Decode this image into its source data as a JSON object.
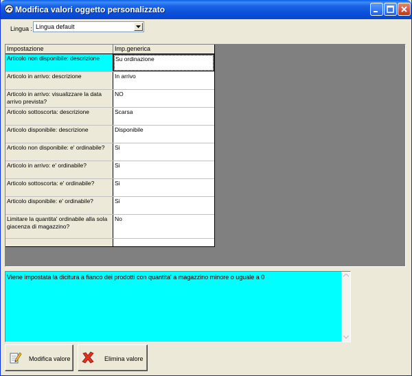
{
  "window": {
    "title": "Modifica valori oggetto personalizzato",
    "title_bar_color": "#0A5FE8"
  },
  "language": {
    "label": "Lingua :",
    "selected": "Lingua default"
  },
  "grid": {
    "columns": [
      "Impostazione",
      "Imp.generica"
    ],
    "rows": [
      {
        "setting": "Articolo non disponibile: descrizione",
        "value": "Su ordinazione"
      },
      {
        "setting": "Articolo in arrivo: descrizione",
        "value": "In arrivo"
      },
      {
        "setting": "Articolo in arrivo: visualizzare la data arrivo prevista?",
        "value": "NO"
      },
      {
        "setting": "Articolo sottoscorta: descrizione",
        "value": "Scarsa"
      },
      {
        "setting": "Articolo disponibile: descrizione",
        "value": "Disponibile"
      },
      {
        "setting": "Articolo non disponibile: e' ordinabile?",
        "value": "Si"
      },
      {
        "setting": "Articolo in arrivo: e' ordinabile?",
        "value": "Si"
      },
      {
        "setting": "Articolo sottoscorta: e' ordinabile?",
        "value": "Si"
      },
      {
        "setting": "Articolo disponibile: e' ordinabile?",
        "value": "Si"
      },
      {
        "setting": "Limitare la quantita' ordinabile alla sola giacenza di magazzino?",
        "value": "No"
      }
    ],
    "selected_color": "#00FFFF"
  },
  "description": {
    "text": "Viene impostata la dicitura a fianco dei prodotti con quantita' a magazzino minore o uguale a 0",
    "background": "#00FFFF"
  },
  "buttons": {
    "edit_label": "Modifica valore",
    "delete_label": "Elimina valore",
    "edit_icon": "edit-document-icon",
    "delete_icon": "red-x-icon"
  }
}
